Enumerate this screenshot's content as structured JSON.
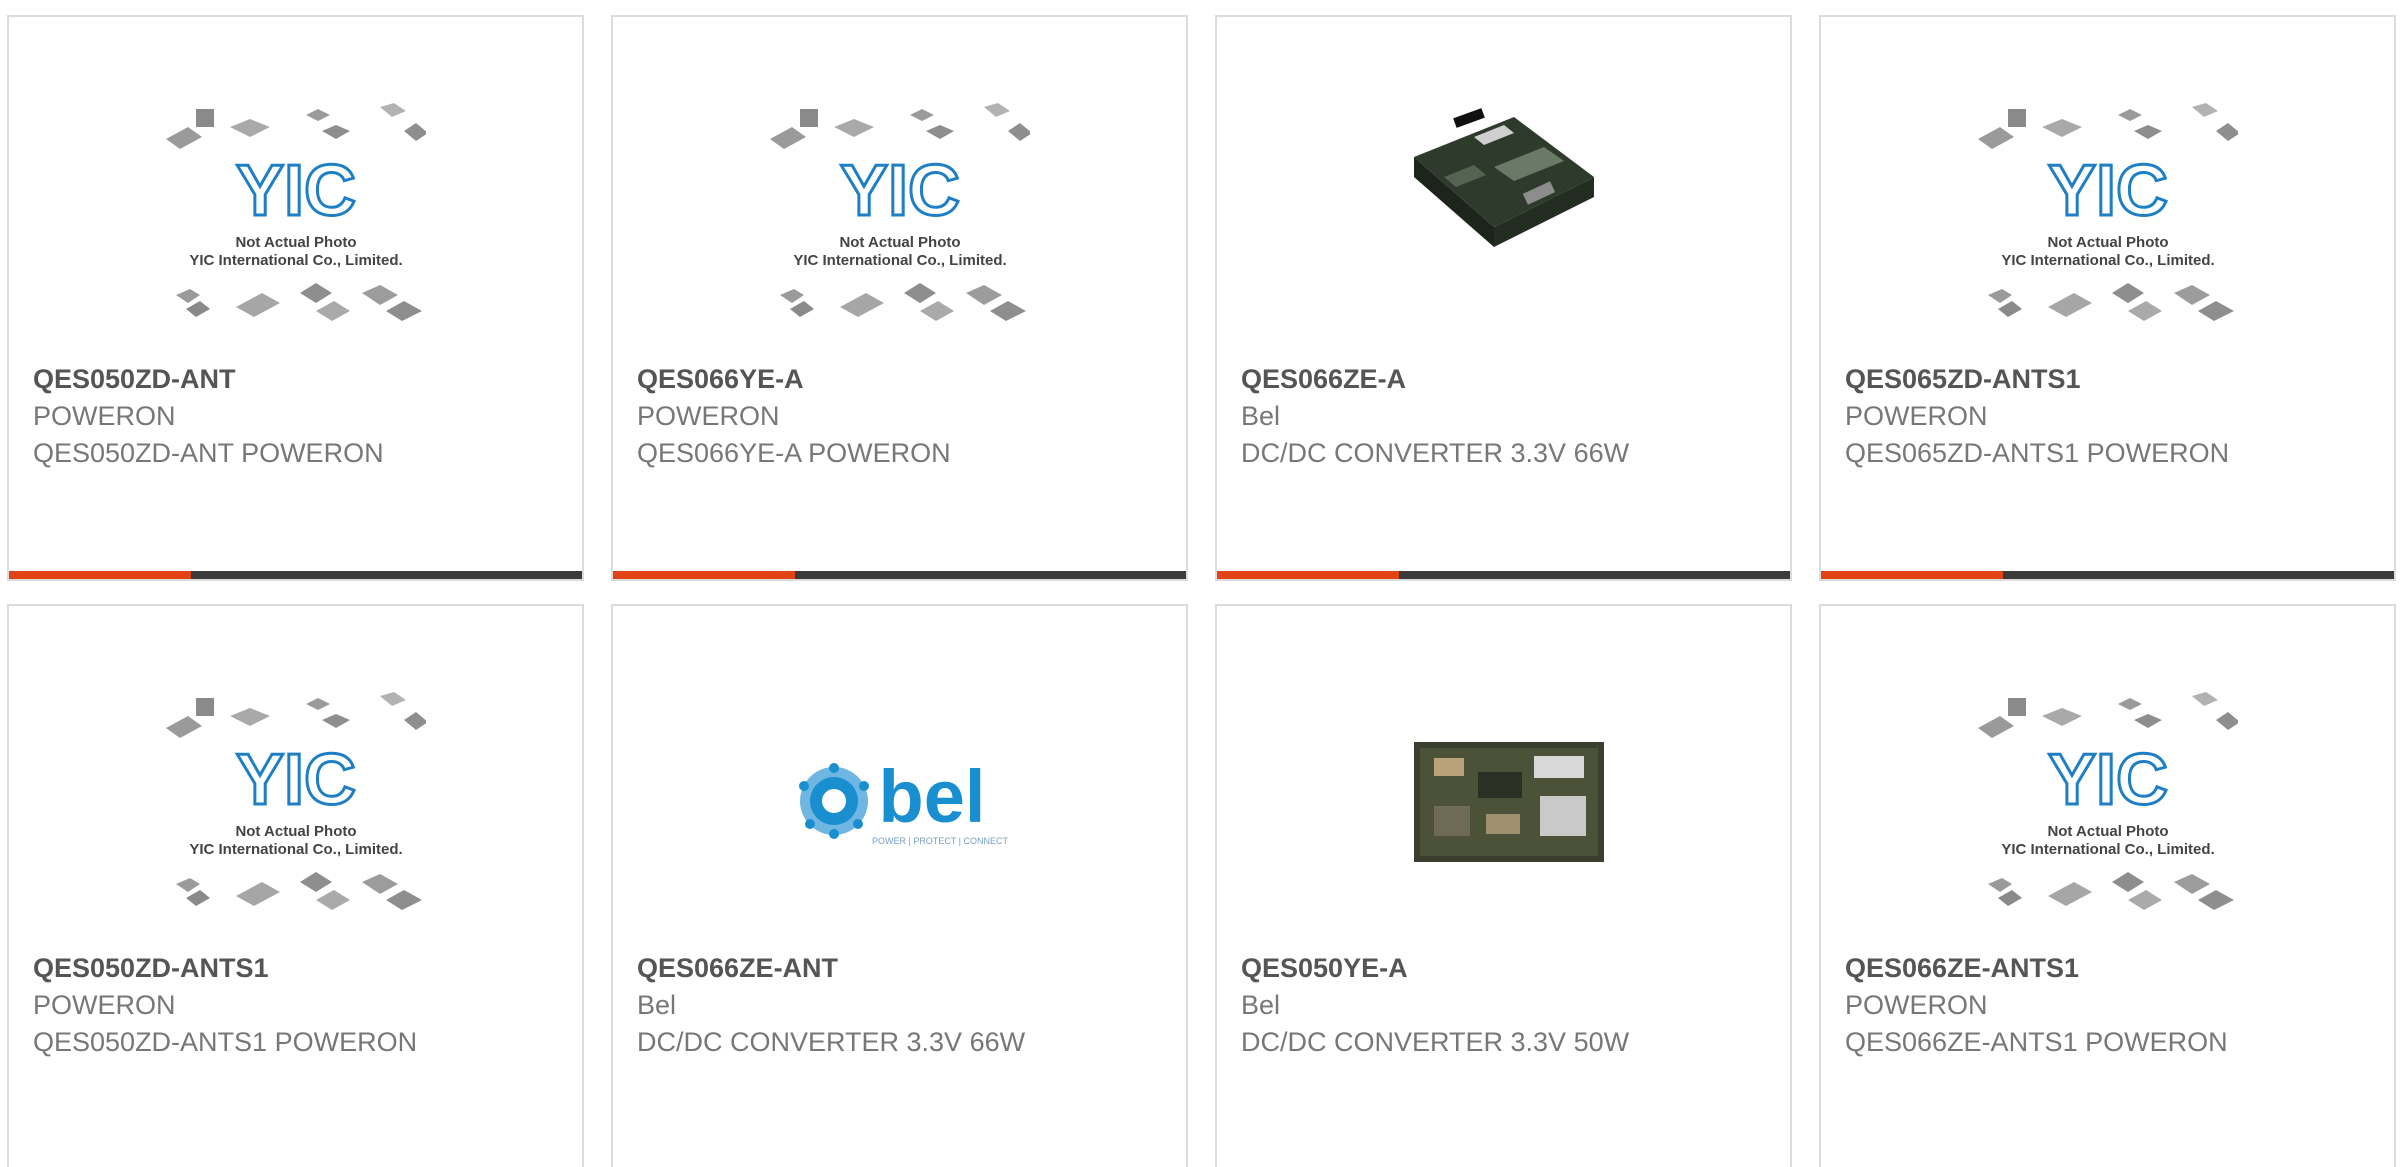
{
  "products": [
    {
      "part_number": "QES050ZD-ANT",
      "manufacturer": "POWERON",
      "description": "QES050ZD-ANT POWERON",
      "image": "placeholder",
      "image_text": [
        "YIC",
        "Not Actual Photo",
        "YIC International Co., Limited."
      ]
    },
    {
      "part_number": "QES066YE-A",
      "manufacturer": "POWERON",
      "description": "QES066YE-A POWERON",
      "image": "placeholder",
      "image_text": [
        "YIC",
        "Not Actual Photo",
        "YIC International Co., Limited."
      ]
    },
    {
      "part_number": "QES066ZE-A",
      "manufacturer": "Bel",
      "description": "DC/DC CONVERTER 3.3V 66W",
      "image": "pcb-module-photo"
    },
    {
      "part_number": "QES065ZD-ANTS1",
      "manufacturer": "POWERON",
      "description": "QES065ZD-ANTS1 POWERON",
      "image": "placeholder",
      "image_text": [
        "YIC",
        "Not Actual Photo",
        "YIC International Co., Limited."
      ]
    },
    {
      "part_number": "QES050ZD-ANTS1",
      "manufacturer": "POWERON",
      "description": "QES050ZD-ANTS1 POWERON",
      "image": "placeholder",
      "image_text": [
        "YIC",
        "Not Actual Photo",
        "YIC International Co., Limited."
      ]
    },
    {
      "part_number": "QES066ZE-ANT",
      "manufacturer": "Bel",
      "description": "DC/DC CONVERTER 3.3V 66W",
      "image": "bel-logo",
      "image_text": [
        "bel",
        "POWER | PROTECT | CONNECT"
      ]
    },
    {
      "part_number": "QES050YE-A",
      "manufacturer": "Bel",
      "description": "DC/DC CONVERTER 3.3V 50W",
      "image": "pcb-board-photo"
    },
    {
      "part_number": "QES066ZE-ANTS1",
      "manufacturer": "POWERON",
      "description": "QES066ZE-ANTS1 POWERON",
      "image": "placeholder",
      "image_text": [
        "YIC",
        "Not Actual Photo",
        "YIC International Co., Limited."
      ]
    }
  ],
  "colors": {
    "accent": "#e14414",
    "bar": "#3a3a3a",
    "border": "#dcdcdc",
    "yic_blue": "#1f7fc4",
    "bel_blue": "#1a8fd0"
  }
}
